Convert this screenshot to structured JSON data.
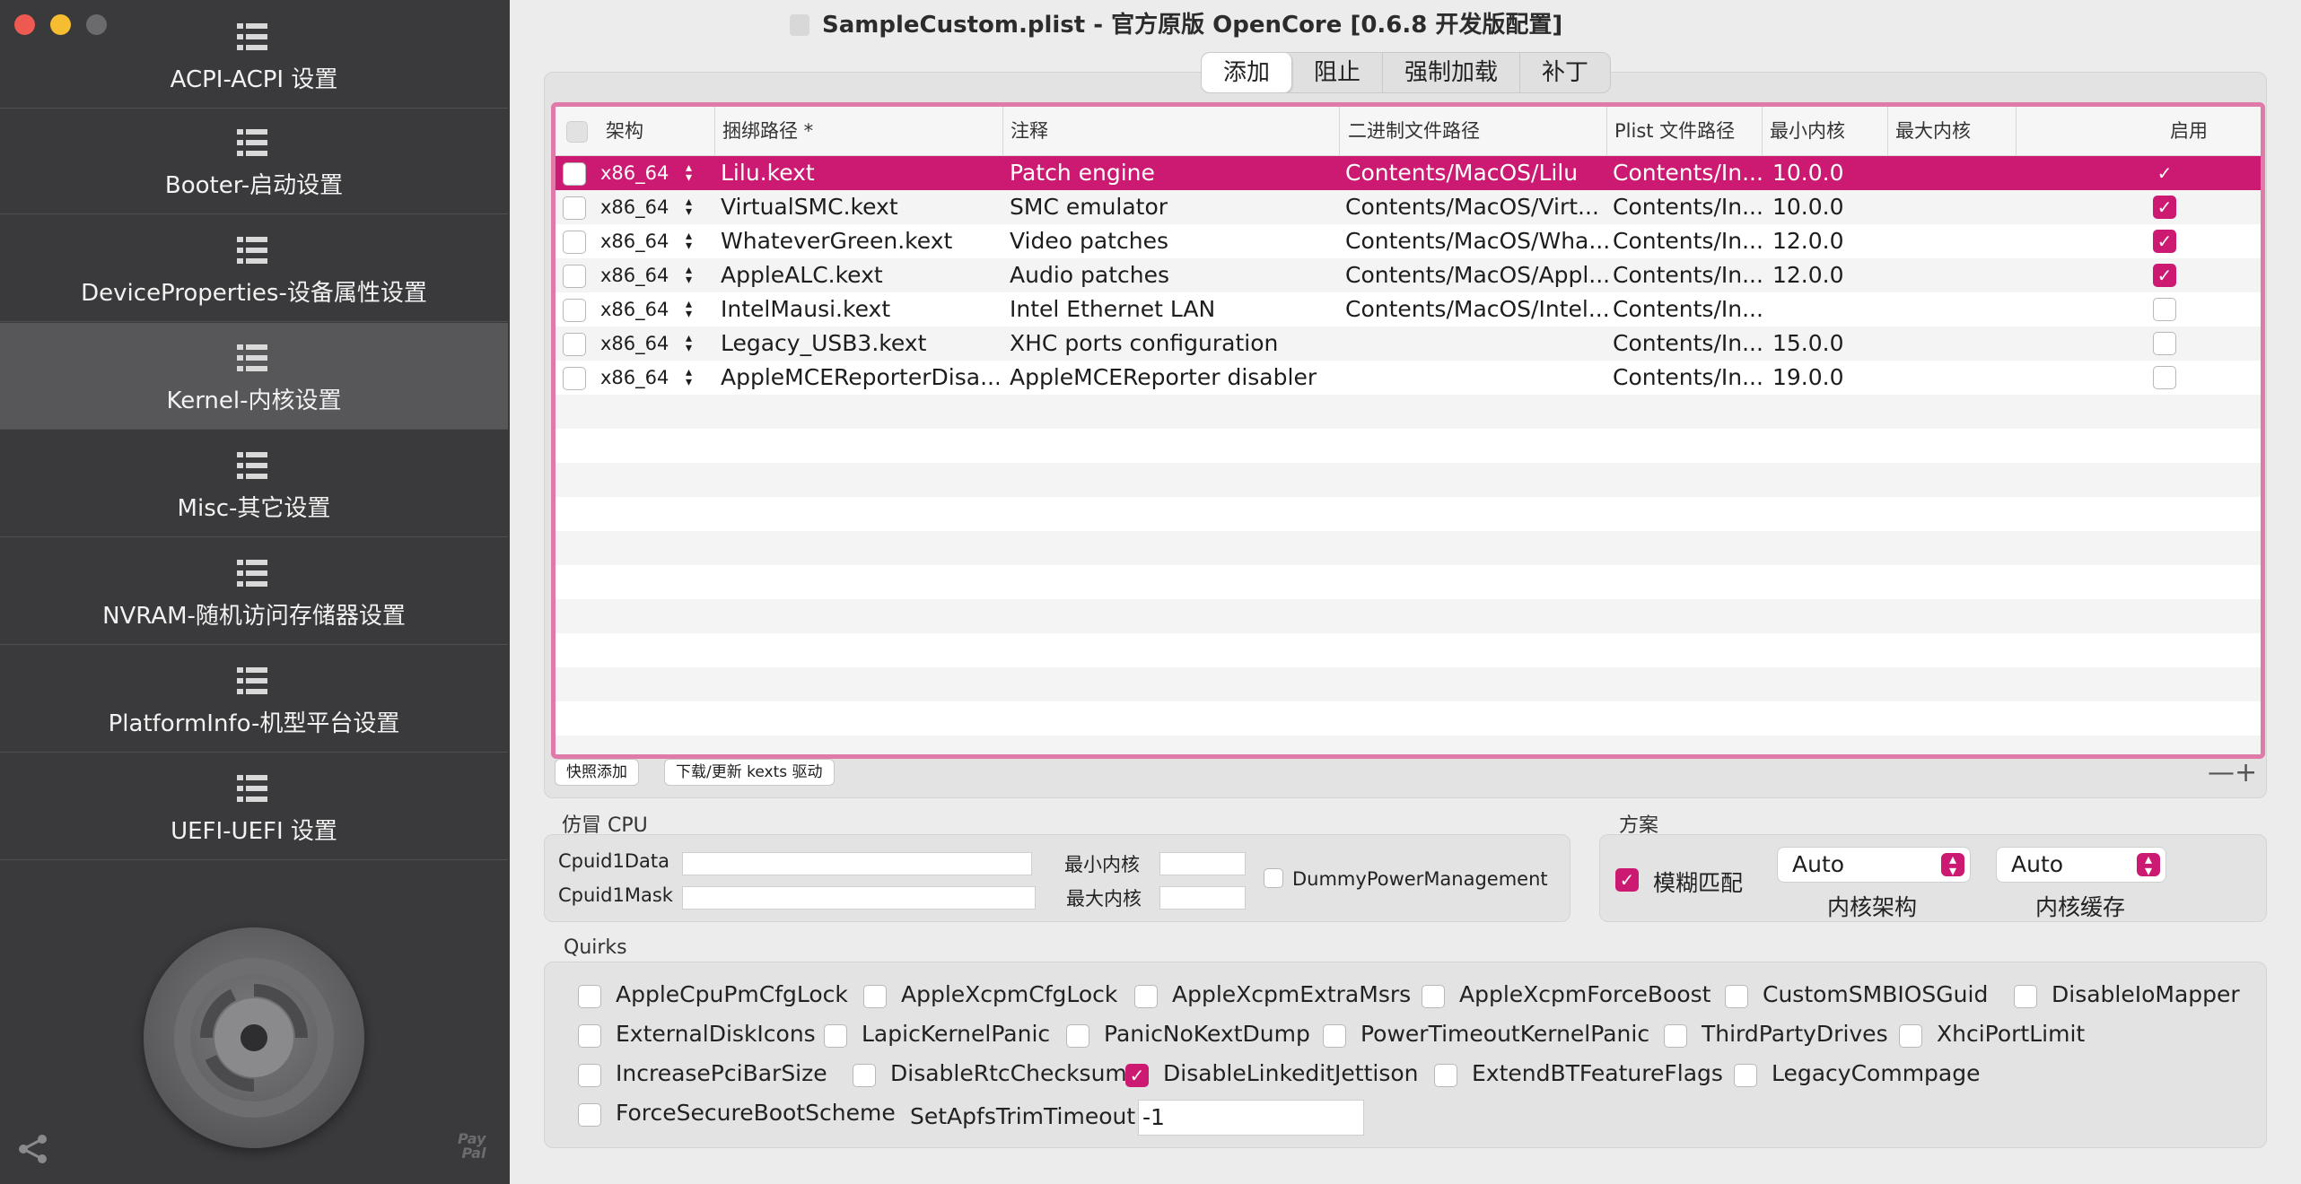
{
  "window": {
    "title": "SampleCustom.plist - 官方原版 OpenCore [0.6.8 开发版配置]"
  },
  "sidebar": {
    "items": [
      {
        "label": "ACPI-ACPI 设置"
      },
      {
        "label": "Booter-启动设置"
      },
      {
        "label": "DeviceProperties-设备属性设置"
      },
      {
        "label": "Kernel-内核设置"
      },
      {
        "label": "Misc-其它设置"
      },
      {
        "label": "NVRAM-随机访问存储器设置"
      },
      {
        "label": "PlatformInfo-机型平台设置"
      },
      {
        "label": "UEFI-UEFI 设置"
      }
    ],
    "active_index": 3,
    "paypal": "Pay\nPal"
  },
  "tabs": [
    {
      "label": "添加"
    },
    {
      "label": "阻止"
    },
    {
      "label": "强制加载"
    },
    {
      "label": "补丁"
    }
  ],
  "table": {
    "columns": [
      "架构",
      "捆绑路径 *",
      "注释",
      "二进制文件路径",
      "Plist 文件路径",
      "最小内核",
      "最大内核",
      "启用"
    ],
    "rows": [
      {
        "arch": "x86_64",
        "bundle": "Lilu.kext",
        "comment": "Patch engine",
        "exec": "Contents/MacOS/Lilu",
        "plist": "Contents/In...",
        "min": "10.0.0",
        "max": "",
        "enabled": true
      },
      {
        "arch": "x86_64",
        "bundle": "VirtualSMC.kext",
        "comment": "SMC emulator",
        "exec": "Contents/MacOS/Virt...",
        "plist": "Contents/In...",
        "min": "10.0.0",
        "max": "",
        "enabled": true
      },
      {
        "arch": "x86_64",
        "bundle": "WhateverGreen.kext",
        "comment": "Video patches",
        "exec": "Contents/MacOS/Wha...",
        "plist": "Contents/In...",
        "min": "12.0.0",
        "max": "",
        "enabled": true
      },
      {
        "arch": "x86_64",
        "bundle": "AppleALC.kext",
        "comment": "Audio patches",
        "exec": "Contents/MacOS/Appl...",
        "plist": "Contents/In...",
        "min": "12.0.0",
        "max": "",
        "enabled": true
      },
      {
        "arch": "x86_64",
        "bundle": "IntelMausi.kext",
        "comment": "Intel Ethernet LAN",
        "exec": "Contents/MacOS/Intel...",
        "plist": "Contents/In...",
        "min": "",
        "max": "",
        "enabled": false
      },
      {
        "arch": "x86_64",
        "bundle": "Legacy_USB3.kext",
        "comment": "XHC ports configuration",
        "exec": "",
        "plist": "Contents/In...",
        "min": "15.0.0",
        "max": "",
        "enabled": false
      },
      {
        "arch": "x86_64",
        "bundle": "AppleMCEReporterDisa...",
        "comment": "AppleMCEReporter disabler",
        "exec": "",
        "plist": "Contents/In...",
        "min": "19.0.0",
        "max": "",
        "enabled": false
      }
    ],
    "selected_index": 0,
    "quick_add_label": "快照添加",
    "download_label": "下载/更新 kexts 驱动",
    "minus_plus": "—+"
  },
  "emulate_cpu": {
    "group_label": "仿冒 CPU",
    "cpuid1data_label": "Cpuid1Data",
    "cpuid1mask_label": "Cpuid1Mask",
    "min_kernel_label": "最小内核",
    "max_kernel_label": "最大内核",
    "dummy_pm_label": "DummyPowerManagement"
  },
  "scheme": {
    "group_label": "方案",
    "fuzzy_label": "模糊匹配",
    "fuzzy_checked": true,
    "kernel_arch_value": "Auto",
    "kernel_arch_label": "内核架构",
    "kernel_cache_value": "Auto",
    "kernel_cache_label": "内核缓存"
  },
  "quirks": {
    "group_label": "Quirks",
    "rows": [
      [
        {
          "label": "AppleCpuPmCfgLock",
          "checked": false
        },
        {
          "label": "AppleXcpmCfgLock",
          "checked": false
        },
        {
          "label": "AppleXcpmExtraMsrs",
          "checked": false
        },
        {
          "label": "AppleXcpmForceBoost",
          "checked": false
        },
        {
          "label": "CustomSMBIOSGuid",
          "checked": false
        },
        {
          "label": "DisableIoMapper",
          "checked": false
        }
      ],
      [
        {
          "label": "ExternalDiskIcons",
          "checked": false
        },
        {
          "label": "LapicKernelPanic",
          "checked": false
        },
        {
          "label": "PanicNoKextDump",
          "checked": false
        },
        {
          "label": "PowerTimeoutKernelPanic",
          "checked": false
        },
        {
          "label": "ThirdPartyDrives",
          "checked": false
        },
        {
          "label": "XhciPortLimit",
          "checked": false
        }
      ],
      [
        {
          "label": "IncreasePciBarSize",
          "checked": false
        },
        {
          "label": "DisableRtcChecksum",
          "checked": false
        },
        {
          "label": "DisableLinkeditJettison",
          "checked": true
        },
        {
          "label": "ExtendBTFeatureFlags",
          "checked": false
        },
        {
          "label": "LegacyCommpage",
          "checked": false
        }
      ],
      [
        {
          "label": "ForceSecureBootScheme",
          "checked": false
        }
      ]
    ],
    "apfs_trim_label": "SetApfsTrimTimeout",
    "apfs_trim_value": "-1"
  },
  "colors": {
    "accent": "#cc1a73",
    "sidebar_bg": "#3a3a3c",
    "table_border": "#e07aa8"
  }
}
